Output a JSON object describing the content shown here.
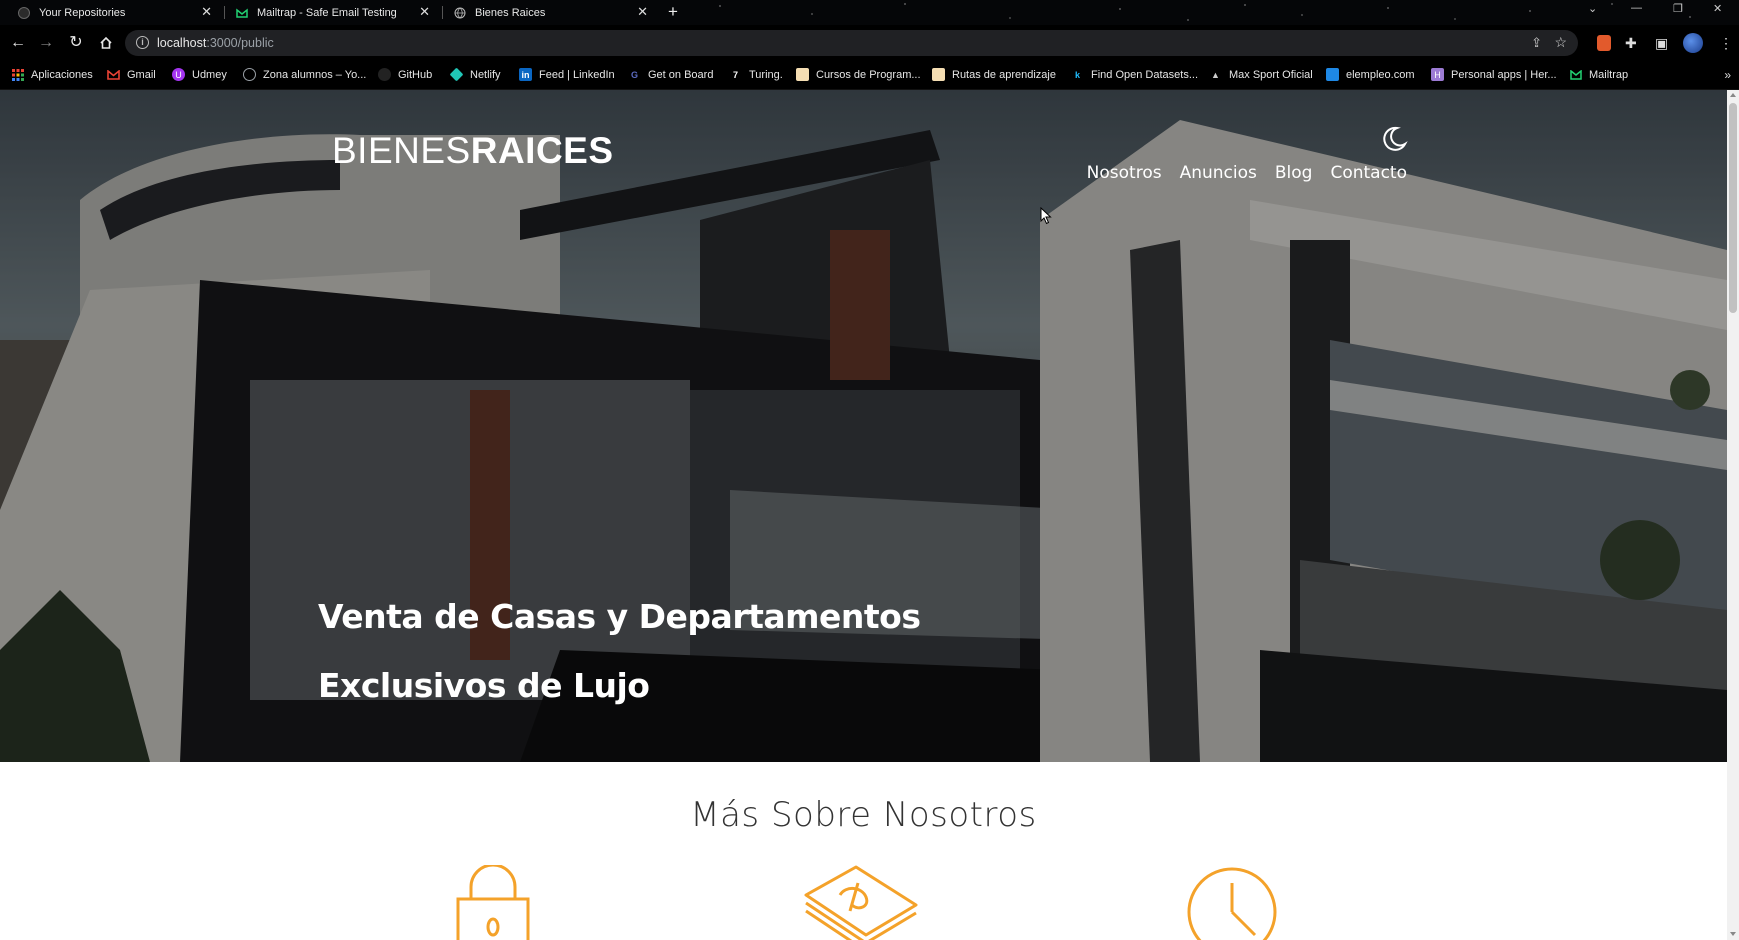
{
  "browser": {
    "tabs": [
      {
        "title": "Your Repositories",
        "icon": "github-icon",
        "active": false
      },
      {
        "title": "Mailtrap - Safe Email Testing",
        "icon": "mailtrap-icon",
        "active": false
      },
      {
        "title": "Bienes Raices",
        "icon": "globe-icon",
        "active": true
      }
    ],
    "new_tab": "+",
    "address": {
      "host": "localhost",
      "path": ":3000/public"
    },
    "bookmarks": [
      {
        "label": "Aplicaciones",
        "icon": "apps-grid-icon",
        "color": "#ea4335"
      },
      {
        "label": "Gmail",
        "icon": "gmail-icon",
        "color": "#ea4335"
      },
      {
        "label": "Udmey",
        "icon": "udemy-icon",
        "color": "#a435f0"
      },
      {
        "label": "Zona alumnos – Yo...",
        "icon": "globe-icon",
        "color": "#9aa0a6"
      },
      {
        "label": "GitHub",
        "icon": "github-icon",
        "color": "#9aa0a6"
      },
      {
        "label": "Netlify",
        "icon": "netlify-icon",
        "color": "#20c6b7"
      },
      {
        "label": "Feed | LinkedIn",
        "icon": "linkedin-icon",
        "color": "#0a66c2"
      },
      {
        "label": "Get on Board",
        "icon": "getonboard-icon",
        "color": "#5c6bc0"
      },
      {
        "label": "Turing.",
        "icon": "turing-icon",
        "color": "#ffffff"
      },
      {
        "label": "Cursos de Program...",
        "icon": "course-icon",
        "color": "#f5deb3"
      },
      {
        "label": "Rutas de aprendizaje",
        "icon": "route-icon",
        "color": "#f5deb3"
      },
      {
        "label": "Find Open Datasets...",
        "icon": "kaggle-icon",
        "color": "#20beff"
      },
      {
        "label": "Max Sport Oficial",
        "icon": "maxsport-icon",
        "color": "#cccccc"
      },
      {
        "label": "elempleo.com",
        "icon": "elempleo-icon",
        "color": "#1e88e5"
      },
      {
        "label": "Personal apps | Her...",
        "icon": "heroku-icon",
        "color": "#9c7bd4"
      },
      {
        "label": "Mailtrap",
        "icon": "mailtrap-icon",
        "color": "#22d172"
      }
    ]
  },
  "site": {
    "logo": {
      "thin": "BIENES",
      "bold": "RAICES"
    },
    "nav": [
      "Nosotros",
      "Anuncios",
      "Blog",
      "Contacto"
    ],
    "hero": {
      "line1": "Venta de Casas y Departamentos",
      "line2": "Exclusivos de Lujo"
    },
    "section_title": "Más Sobre Nosotros",
    "features": [
      {
        "icon": "lock-icon"
      },
      {
        "icon": "money-icon"
      },
      {
        "icon": "clock-icon"
      }
    ],
    "accent_color": "#f4a22a"
  }
}
